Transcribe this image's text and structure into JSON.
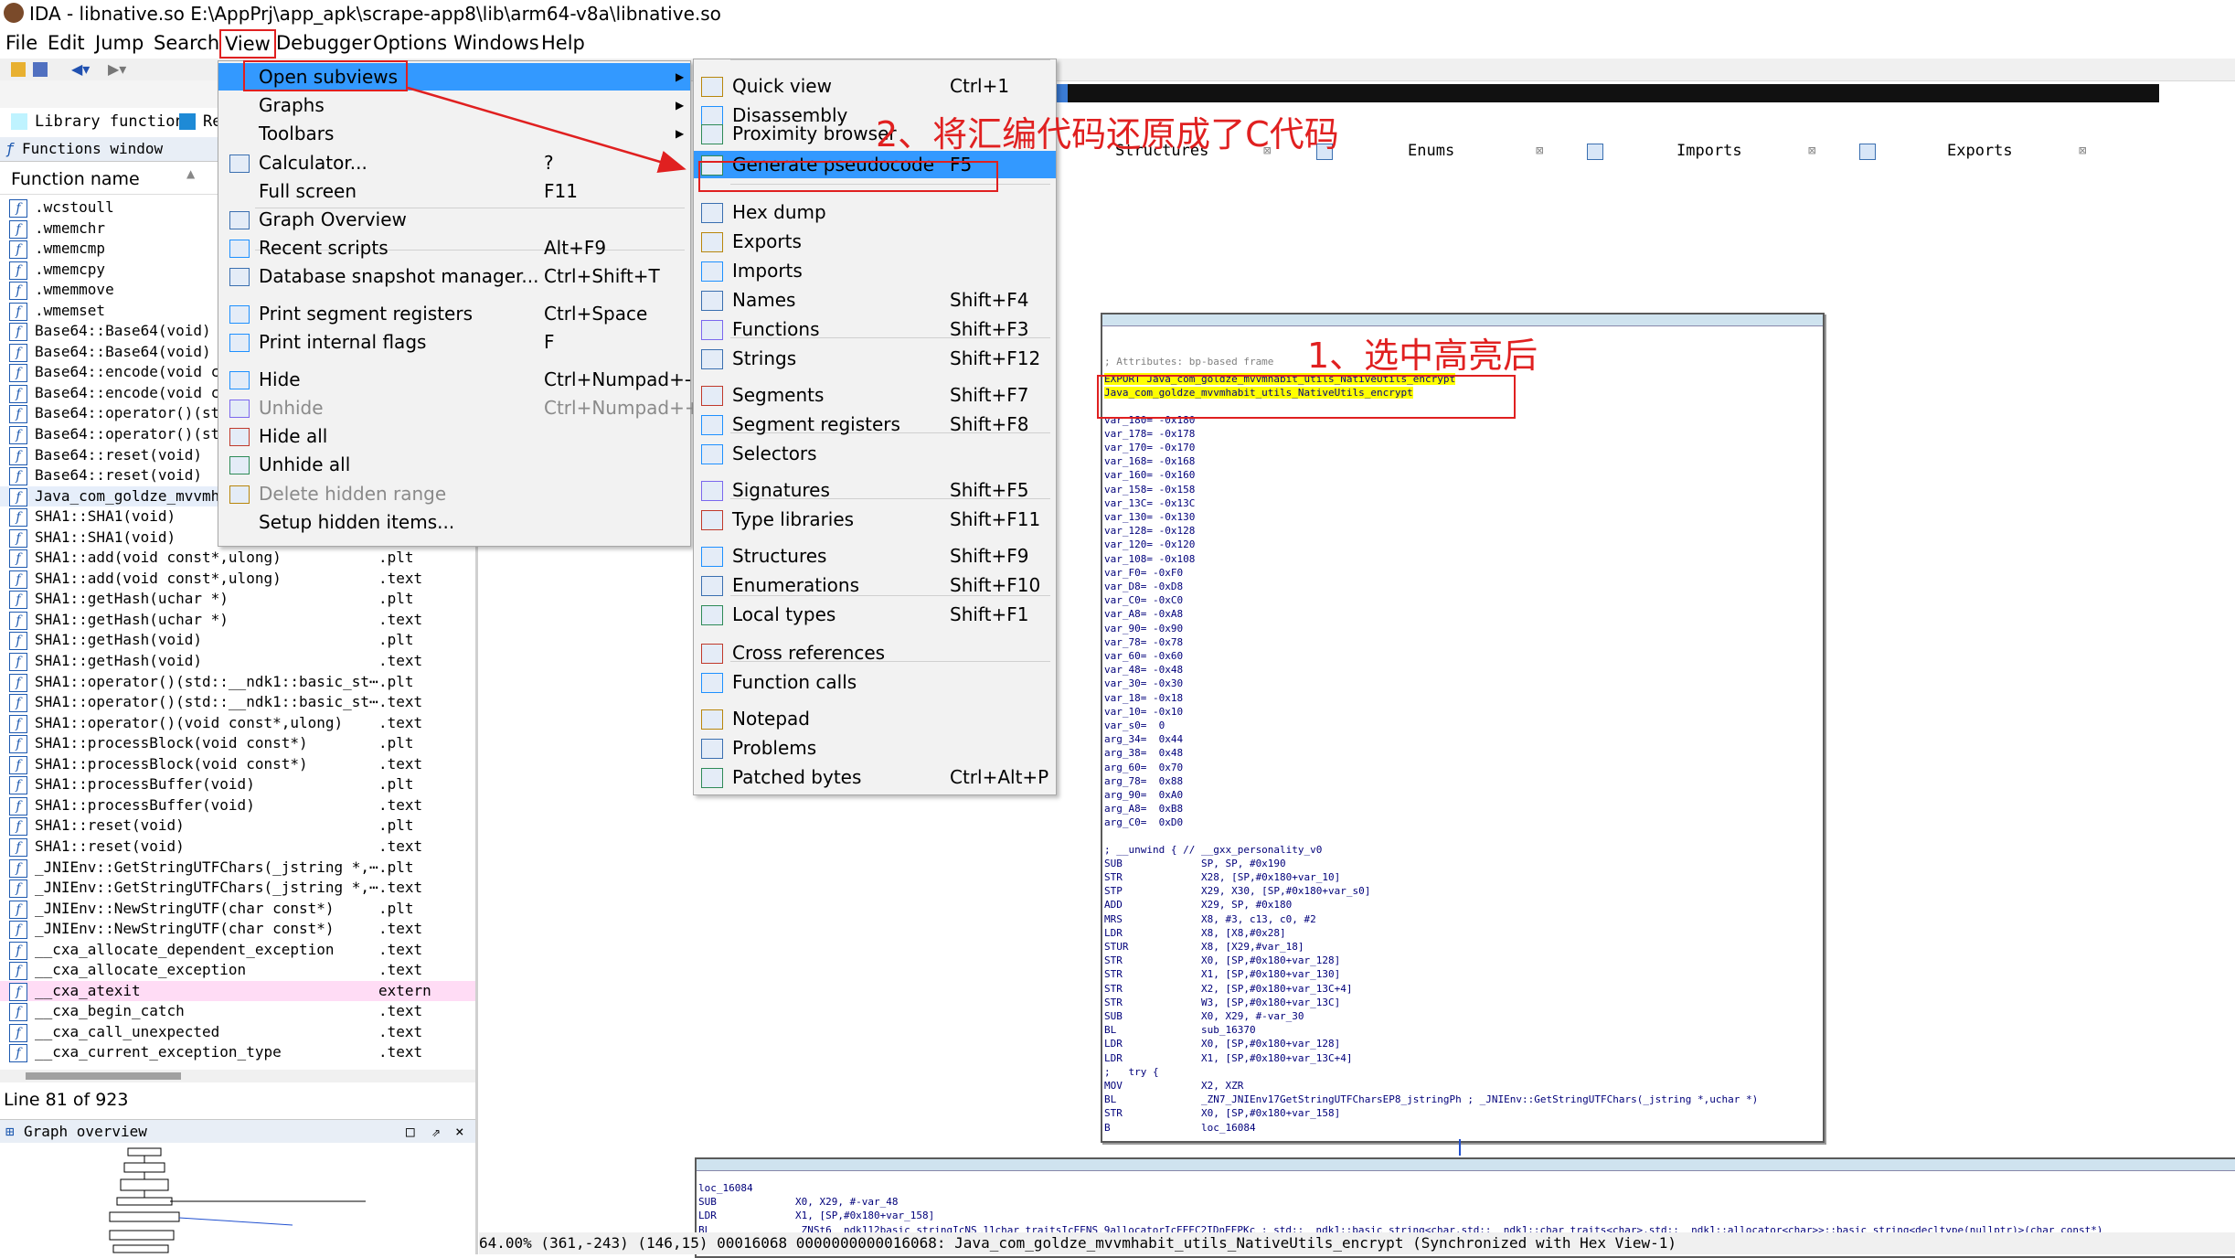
{
  "window": {
    "title": "IDA - libnative.so E:\\AppPrj\\app_apk\\scrape-app8\\lib\\arm64-v8a\\libnative.so"
  },
  "menubar": [
    "File",
    "Edit",
    "Jump",
    "Search",
    "View",
    "Debugger",
    "Options",
    "Windows",
    "Help"
  ],
  "legend": {
    "library_function": "Library function",
    "regular_function": "Re"
  },
  "functions_window": {
    "tab_title": "Functions window",
    "header": "Function name",
    "rows": [
      {
        "name": ".wcstoull",
        "seg": ""
      },
      {
        "name": ".wmemchr",
        "seg": ""
      },
      {
        "name": ".wmemcmp",
        "seg": ""
      },
      {
        "name": ".wmemcpy",
        "seg": ""
      },
      {
        "name": ".wmemmove",
        "seg": ""
      },
      {
        "name": ".wmemset",
        "seg": ""
      },
      {
        "name": "Base64::Base64(void)",
        "seg": ""
      },
      {
        "name": "Base64::Base64(void)",
        "seg": ""
      },
      {
        "name": "Base64::encode(void co",
        "seg": ""
      },
      {
        "name": "Base64::encode(void co",
        "seg": ""
      },
      {
        "name": "Base64::operator()(sto",
        "seg": ""
      },
      {
        "name": "Base64::operator()(sto",
        "seg": ""
      },
      {
        "name": "Base64::reset(void)",
        "seg": ""
      },
      {
        "name": "Base64::reset(void)",
        "seg": ""
      },
      {
        "name": "Java_com_goldze_mvvmha",
        "seg": ""
      },
      {
        "name": "SHA1::SHA1(void)",
        "seg": ""
      },
      {
        "name": "SHA1::SHA1(void)",
        "seg": ""
      },
      {
        "name": "SHA1::add(void const*,ulong)",
        "seg": ".plt"
      },
      {
        "name": "SHA1::add(void const*,ulong)",
        "seg": ".text"
      },
      {
        "name": "SHA1::getHash(uchar *)",
        "seg": ".plt"
      },
      {
        "name": "SHA1::getHash(uchar *)",
        "seg": ".text"
      },
      {
        "name": "SHA1::getHash(void)",
        "seg": ".plt"
      },
      {
        "name": "SHA1::getHash(void)",
        "seg": ".text"
      },
      {
        "name": "SHA1::operator()(std::__ndk1::basic_st⋯",
        "seg": ".plt"
      },
      {
        "name": "SHA1::operator()(std::__ndk1::basic_st⋯",
        "seg": ".text"
      },
      {
        "name": "SHA1::operator()(void const*,ulong)",
        "seg": ".text"
      },
      {
        "name": "SHA1::processBlock(void const*)",
        "seg": ".plt"
      },
      {
        "name": "SHA1::processBlock(void const*)",
        "seg": ".text"
      },
      {
        "name": "SHA1::processBuffer(void)",
        "seg": ".plt"
      },
      {
        "name": "SHA1::processBuffer(void)",
        "seg": ".text"
      },
      {
        "name": "SHA1::reset(void)",
        "seg": ".plt"
      },
      {
        "name": "SHA1::reset(void)",
        "seg": ".text"
      },
      {
        "name": "_JNIEnv::GetStringUTFChars(_jstring *,⋯",
        "seg": ".plt"
      },
      {
        "name": "_JNIEnv::GetStringUTFChars(_jstring *,⋯",
        "seg": ".text"
      },
      {
        "name": "_JNIEnv::NewStringUTF(char const*)",
        "seg": ".plt"
      },
      {
        "name": "_JNIEnv::NewStringUTF(char const*)",
        "seg": ".text"
      },
      {
        "name": "__cxa_allocate_dependent_exception",
        "seg": ".text"
      },
      {
        "name": "__cxa_allocate_exception",
        "seg": ".text"
      },
      {
        "name": "__cxa_atexit",
        "seg": "extern"
      },
      {
        "name": "__cxa_begin_catch",
        "seg": ".text"
      },
      {
        "name": "__cxa_call_unexpected",
        "seg": ".text"
      },
      {
        "name": "__cxa_current_exception_type",
        "seg": ".text"
      }
    ],
    "status": "Line 81 of 923"
  },
  "graph_overview": {
    "title": "Graph overview"
  },
  "view_menu": {
    "items": [
      {
        "label": "Open subviews",
        "shortcut": "",
        "sub": true,
        "icon": "none-icon"
      },
      {
        "label": "Graphs",
        "shortcut": "",
        "sub": true,
        "icon": "none-icon"
      },
      {
        "label": "Toolbars",
        "shortcut": "",
        "sub": true,
        "icon": "none-icon"
      },
      {
        "label": "Calculator...",
        "shortcut": "?",
        "icon": "calculator-icon"
      },
      {
        "label": "Full screen",
        "shortcut": "F11",
        "icon": "none-icon"
      },
      {
        "label": "Graph Overview",
        "shortcut": "",
        "icon": "graph-overview-icon"
      },
      {
        "label": "Recent scripts",
        "shortcut": "Alt+F9",
        "icon": "scripts-icon"
      },
      {
        "label": "Database snapshot manager...",
        "shortcut": "Ctrl+Shift+T",
        "icon": "snapshot-icon"
      },
      {
        "label": "Print segment registers",
        "shortcut": "Ctrl+Space",
        "icon": "print-registers-icon"
      },
      {
        "label": "Print internal flags",
        "shortcut": "F",
        "icon": "info-icon"
      },
      {
        "label": "Hide",
        "shortcut": "Ctrl+Numpad+-",
        "icon": "hide-icon"
      },
      {
        "label": "Unhide",
        "shortcut": "Ctrl+Numpad++",
        "disabled": true,
        "icon": "unhide-icon"
      },
      {
        "label": "Hide all",
        "shortcut": "",
        "icon": "hide-all-icon"
      },
      {
        "label": "Unhide all",
        "shortcut": "",
        "icon": "unhide-all-icon"
      },
      {
        "label": "Delete hidden range",
        "shortcut": "",
        "disabled": true,
        "icon": "delete-icon"
      },
      {
        "label": "Setup hidden items...",
        "shortcut": "",
        "icon": "none-icon"
      }
    ]
  },
  "subviews_menu": {
    "items": [
      {
        "label": "Quick view",
        "shortcut": "Ctrl+1",
        "icon": "quick-view-icon"
      },
      {
        "label": "Disassembly",
        "shortcut": "",
        "icon": "disassembly-icon"
      },
      {
        "label": "Proximity browser",
        "shortcut": "",
        "icon": "proximity-icon"
      },
      {
        "label": "Generate pseudocode",
        "shortcut": "F5",
        "icon": "pseudocode-icon"
      },
      {
        "label": "Hex dump",
        "shortcut": "",
        "icon": "hex-dump-icon"
      },
      {
        "label": "Exports",
        "shortcut": "",
        "icon": "exports-icon"
      },
      {
        "label": "Imports",
        "shortcut": "",
        "icon": "imports-icon"
      },
      {
        "label": "Names",
        "shortcut": "Shift+F4",
        "icon": "names-icon"
      },
      {
        "label": "Functions",
        "shortcut": "Shift+F3",
        "icon": "functions-icon"
      },
      {
        "label": "Strings",
        "shortcut": "Shift+F12",
        "icon": "strings-icon"
      },
      {
        "label": "Segments",
        "shortcut": "Shift+F7",
        "icon": "segments-icon"
      },
      {
        "label": "Segment registers",
        "shortcut": "Shift+F8",
        "icon": "segment-registers-icon"
      },
      {
        "label": "Selectors",
        "shortcut": "",
        "icon": "selectors-icon"
      },
      {
        "label": "Signatures",
        "shortcut": "Shift+F5",
        "icon": "signatures-icon"
      },
      {
        "label": "Type libraries",
        "shortcut": "Shift+F11",
        "icon": "type-libraries-icon"
      },
      {
        "label": "Structures",
        "shortcut": "Shift+F9",
        "icon": "structures-icon"
      },
      {
        "label": "Enumerations",
        "shortcut": "Shift+F10",
        "icon": "enumerations-icon"
      },
      {
        "label": "Local types",
        "shortcut": "Shift+F1",
        "icon": "local-types-icon"
      },
      {
        "label": "Cross references",
        "shortcut": "",
        "icon": "xrefs-icon"
      },
      {
        "label": "Function calls",
        "shortcut": "",
        "icon": "function-calls-icon"
      },
      {
        "label": "Notepad",
        "shortcut": "",
        "icon": "notepad-icon"
      },
      {
        "label": "Problems",
        "shortcut": "",
        "icon": "problems-icon"
      },
      {
        "label": "Patched bytes",
        "shortcut": "Ctrl+Alt+P",
        "icon": "patched-bytes-icon"
      }
    ]
  },
  "tabs": [
    "Structures",
    "Enums",
    "Imports",
    "Exports"
  ],
  "annotations": {
    "step1": "1、选中高亮后",
    "step2": "2、将汇编代码还原成了C代码"
  },
  "disasm": {
    "attributes": "; Attributes: bp-based frame",
    "export_line": "EXPORT Java_com_goldze_mvvmhabit_utils_NativeUtils_encrypt",
    "label_line": "Java_com_goldze_mvvmhabit_utils_NativeUtils_encrypt",
    "vars": [
      "var_180= -0x180",
      "var_178= -0x178",
      "var_170= -0x170",
      "var_168= -0x168",
      "var_160= -0x160",
      "var_158= -0x158",
      "var_13C= -0x13C",
      "var_130= -0x130",
      "var_128= -0x128",
      "var_120= -0x120",
      "var_108= -0x108",
      "var_F0= -0xF0",
      "var_D8= -0xD8",
      "var_C0= -0xC0",
      "var_A8= -0xA8",
      "var_90= -0x90",
      "var_78= -0x78",
      "var_60= -0x60",
      "var_48= -0x48",
      "var_30= -0x30",
      "var_18= -0x18",
      "var_10= -0x10",
      "var_s0=  0",
      "arg_34=  0x44",
      "arg_38=  0x48",
      "arg_60=  0x70",
      "arg_78=  0x88",
      "arg_90=  0xA0",
      "arg_A8=  0xB8",
      "arg_C0=  0xD0"
    ],
    "unwind": "; __unwind { // __gxx_personality_v0",
    "instructions": [
      "SUB             SP, SP, #0x190",
      "STR             X28, [SP,#0x180+var_10]",
      "STP             X29, X30, [SP,#0x180+var_s0]",
      "ADD             X29, SP, #0x180",
      "MRS             X8, #3, c13, c0, #2",
      "LDR             X8, [X8,#0x28]",
      "STUR            X8, [X29,#var_18]",
      "STR             X0, [SP,#0x180+var_128]",
      "STR             X1, [SP,#0x180+var_130]",
      "STR             X2, [SP,#0x180+var_13C+4]",
      "STR             W3, [SP,#0x180+var_13C]",
      "SUB             X0, X29, #-var_30",
      "BL              sub_16370",
      "LDR             X0, [SP,#0x180+var_128]",
      "LDR             X1, [SP,#0x180+var_13C+4]",
      ";   try {",
      "MOV             X2, XZR",
      "BL              _ZN7_JNIEnv17GetStringUTFCharsEP8_jstringPh ; _JNIEnv::GetStringUTFChars(_jstring *,uchar *)",
      "STR             X0, [SP,#0x180+var_158]",
      "B               loc_16084"
    ],
    "node2_lines": [
      "loc_16084",
      "SUB             X0, X29, #-var_48",
      "LDR             X1, [SP,#0x180+var_158]",
      "BL              _ZNSt6__ndk112basic_stringIcNS_11char_traitsIcEENS_9allocatorIcEEEC2IDnEEPKc ; std::__ndk1::basic_string<char,std::__ndk1::char_traits<char>,std::__ndk1::allocator<char>>::basic_string<decltype(nullptr)>(char const*)"
    ]
  },
  "bottom_status": "64.00% (361,-243) (146,15) 00016068 0000000000016068: Java_com_goldze_mvvmhabit_utils_NativeUtils_encrypt (Synchronized with Hex View-1)",
  "colors": {
    "highlight": "#ffff00",
    "menu_selection": "#3399ff",
    "annotation_red": "#e02020",
    "asm_blue": "#00007a"
  }
}
